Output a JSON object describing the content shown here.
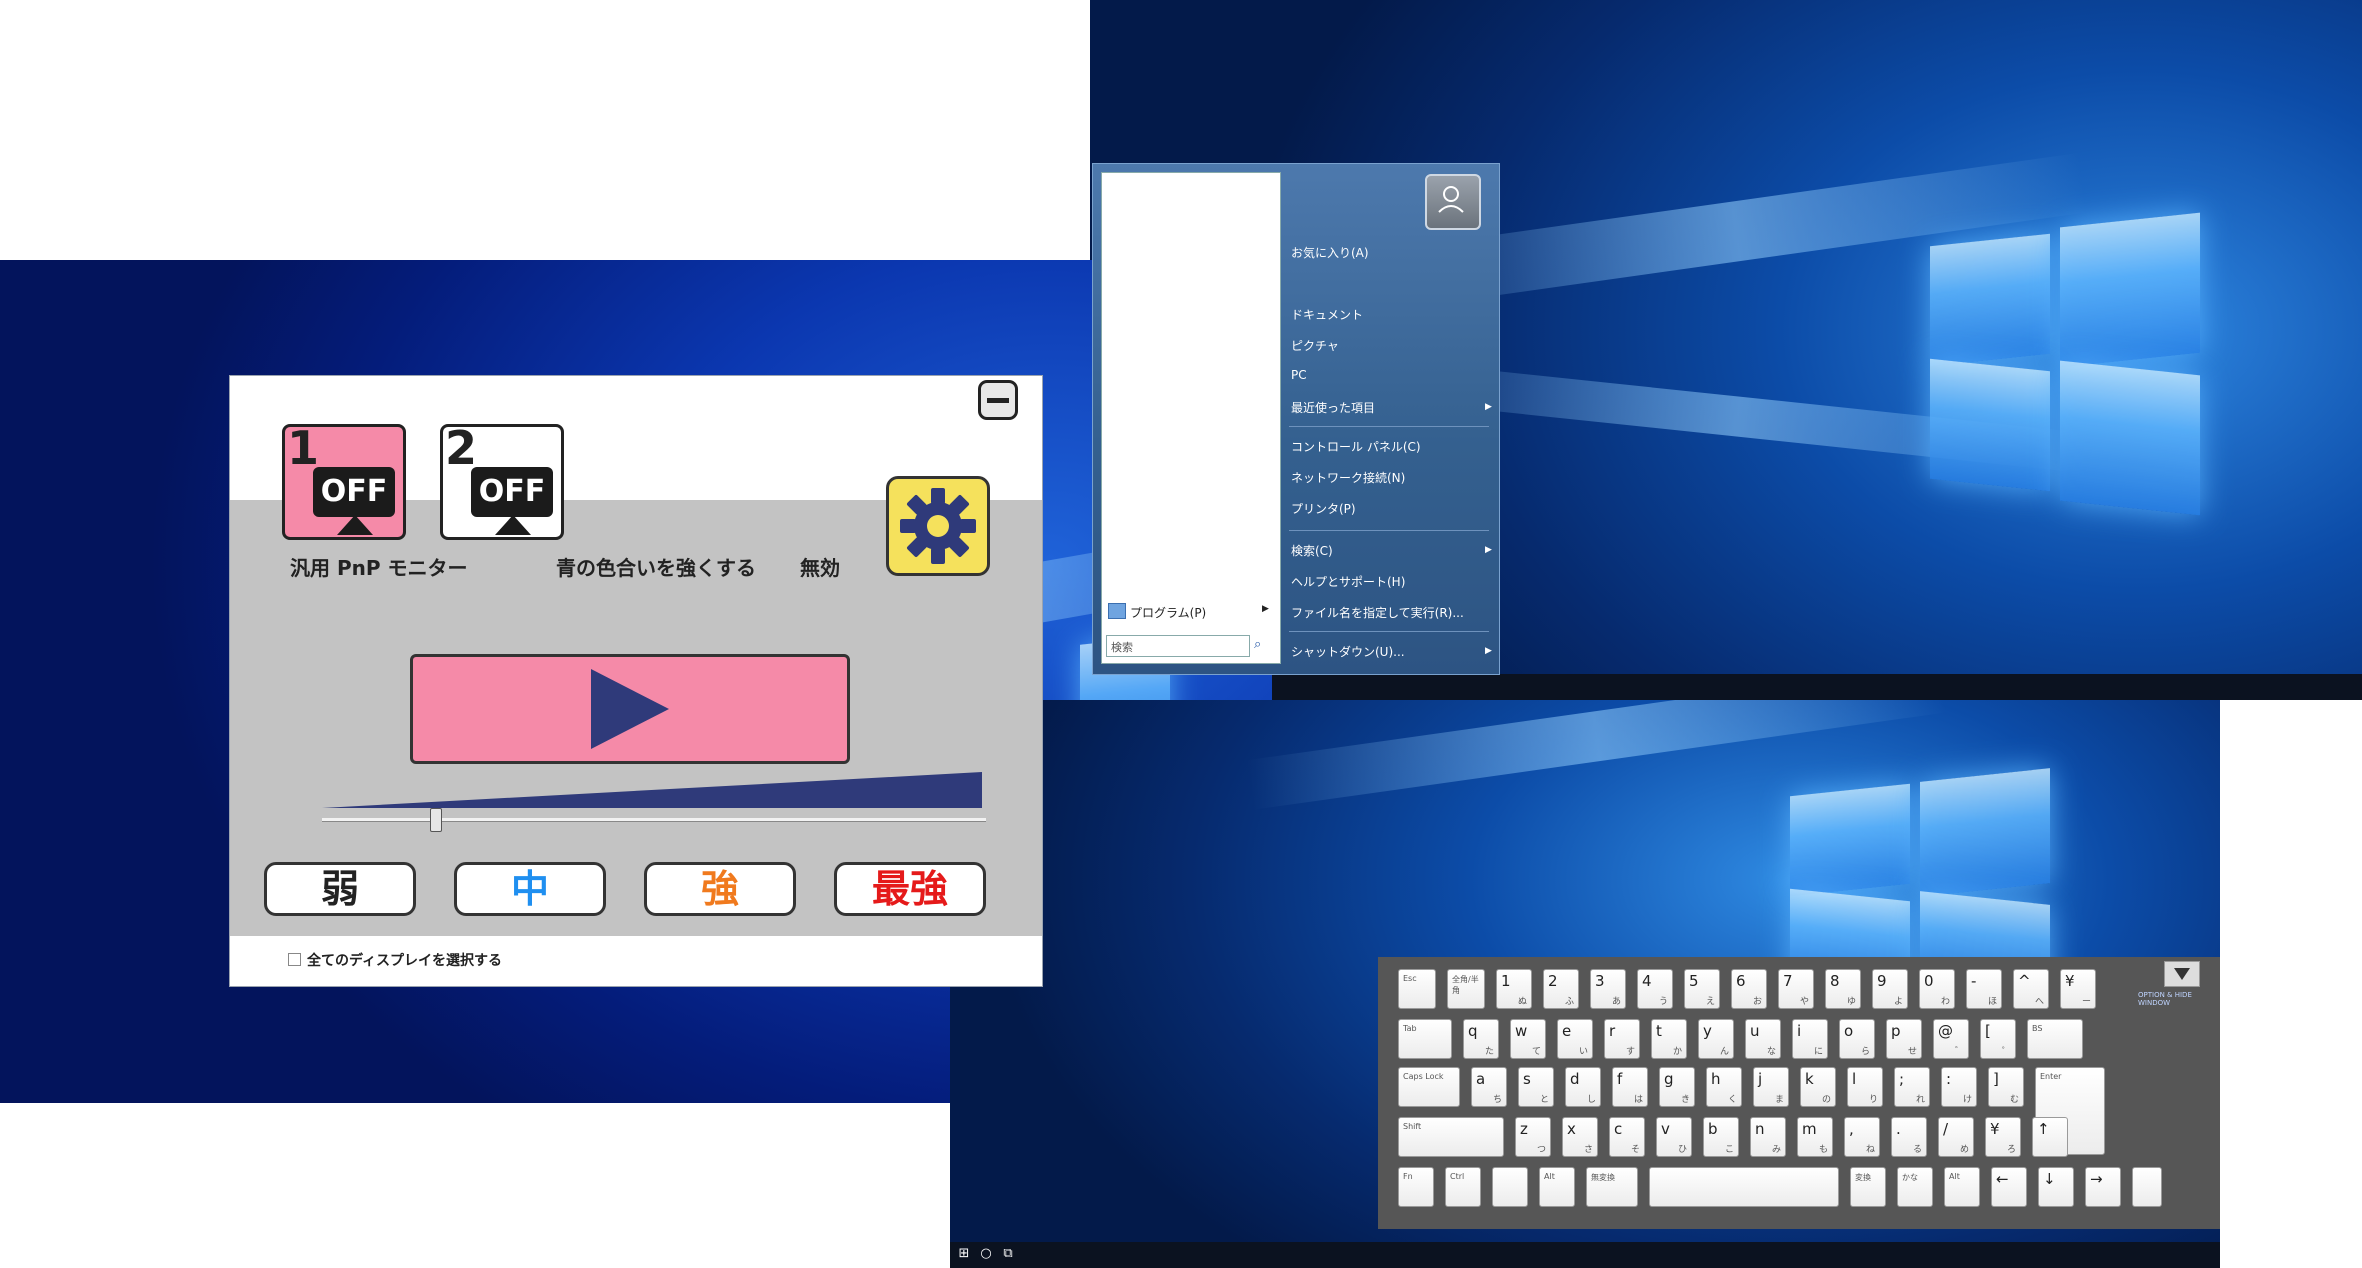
{
  "app": {
    "monitor1": {
      "number": "1",
      "state": "OFF"
    },
    "monitor2": {
      "number": "2",
      "state": "OFF"
    },
    "monitor_name": "汎用 PnP モニター",
    "mode_label": "青の色合いを強くする",
    "status_label": "無効",
    "levels": [
      {
        "label": "弱",
        "color": "#222222"
      },
      {
        "label": "中",
        "color": "#1f8ff0"
      },
      {
        "label": "強",
        "color": "#f07a1e"
      },
      {
        "label": "最強",
        "color": "#e51a1a"
      }
    ],
    "strength": 0.17,
    "select_all_label": "全てのディスプレイを選択する",
    "colors": {
      "accent_pink": "#f58aa8",
      "gear_yellow": "#f5e15c",
      "navy": "#2f3a7a"
    }
  },
  "start_menu": {
    "items": [
      {
        "label": "お気に入り(A)"
      },
      {
        "label": "ドキュメント"
      },
      {
        "label": "ピクチャ"
      },
      {
        "label": "PC"
      },
      {
        "label": "最近使った項目"
      },
      {
        "label": "コントロール パネル(C)"
      },
      {
        "label": "ネットワーク接続(N)"
      },
      {
        "label": "プリンタ(P)"
      },
      {
        "label": "検索(C)"
      },
      {
        "label": "ヘルプとサポート(H)"
      },
      {
        "label": "ファイル名を指定して実行(R)..."
      },
      {
        "label": "シャットダウン(U)..."
      }
    ],
    "programs_label": "プログラム(P)",
    "search_placeholder": "検索"
  },
  "keyboard": {
    "row1": [
      "Esc",
      "全角/半角",
      "1",
      "2",
      "3",
      "4",
      "5",
      "6",
      "7",
      "8",
      "9",
      "0",
      "-",
      "^",
      "¥"
    ],
    "row1_kana": [
      "",
      "",
      "ぬ",
      "ふ",
      "あ",
      "う",
      "え",
      "お",
      "や",
      "ゆ",
      "よ",
      "わ",
      "ほ",
      "へ",
      "ー"
    ],
    "row2": [
      "Tab",
      "q",
      "w",
      "e",
      "r",
      "t",
      "y",
      "u",
      "i",
      "o",
      "p",
      "@",
      "[",
      "BS"
    ],
    "row2_kana": [
      "",
      "た",
      "て",
      "い",
      "す",
      "か",
      "ん",
      "な",
      "に",
      "ら",
      "せ",
      "゛",
      "゜",
      ""
    ],
    "row3": [
      "Caps Lock",
      "a",
      "s",
      "d",
      "f",
      "g",
      "h",
      "j",
      "k",
      "l",
      ";",
      ":",
      "]",
      "Enter"
    ],
    "row3_kana": [
      "",
      "ち",
      "と",
      "し",
      "は",
      "き",
      "く",
      "ま",
      "の",
      "り",
      "れ",
      "け",
      "む",
      ""
    ],
    "row4": [
      "Shift",
      "z",
      "x",
      "c",
      "v",
      "b",
      "n",
      "m",
      ",",
      ".",
      "/",
      "¥",
      "↑"
    ],
    "row4_kana": [
      "",
      "つ",
      "さ",
      "そ",
      "ひ",
      "こ",
      "み",
      "も",
      "ね",
      "る",
      "め",
      "ろ",
      ""
    ],
    "row5": [
      "Fn",
      "Ctrl",
      "",
      "Alt",
      "無変換",
      "",
      "変換",
      "かな",
      "Alt",
      "←",
      "↓",
      "→",
      ""
    ],
    "brand": "OPTION & HIDE WINDOW"
  }
}
